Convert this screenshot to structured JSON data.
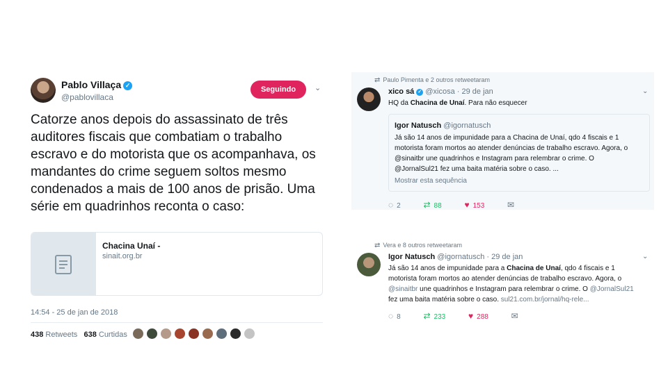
{
  "left_tweet": {
    "name": "Pablo Villaça",
    "handle": "@pablovillaca",
    "follow_button": "Seguindo",
    "text": "Catorze anos depois do assassinato de três auditores fiscais que combatiam o trabalho escravo e do motorista que os acompanhava, os mandantes do crime seguem soltos mesmo condenados a mais de 100 anos de prisão. Uma série em quadrinhos reconta o caso:",
    "card": {
      "title": "Chacina Unaí -",
      "domain": "sinait.org.br"
    },
    "timestamp": "14:54 - 25 de jan de 2018",
    "retweets_count": "438",
    "retweets_label": "Retweets",
    "likes_count": "638",
    "likes_label": "Curtidas"
  },
  "right_tweet_1": {
    "retweeted_by": "Paulo Pimenta e 2 outros retweetaram",
    "name": "xico sá",
    "handle": "@xicosa",
    "date": "· 29 de jan",
    "text_before": "HQ da ",
    "text_bold": "Chacina de Unaí",
    "text_after": ". Para não esquecer",
    "quote": {
      "name": "Igor Natusch",
      "handle": "@igornatusch",
      "line1": "Já são 14 anos de impunidade para a Chacina de Unaí, qdo 4 fiscais e 1",
      "line2": "motorista foram mortos ao atender denúncias de trabalho escravo. Agora, o",
      "line3": "@sinaitbr une quadrinhos e Instagram para relembrar o crime. O",
      "line4": "@JornalSul21 fez uma baita matéria sobre o caso. ...",
      "show_thread": "Mostrar esta sequência"
    },
    "replies": "2",
    "retweets": "88",
    "likes": "153"
  },
  "right_tweet_2": {
    "retweeted_by": "Vera e 8 outros retweetaram",
    "name": "Igor Natusch",
    "handle": "@igornatusch",
    "date": "· 29 de jan",
    "l1a": "Já são 14 anos de impunidade para a ",
    "l1b": "Chacina de Unaí",
    "l1c": ", qdo 4 fiscais e 1",
    "l2": "motorista foram mortos ao atender denúncias de trabalho escravo. Agora, o",
    "l3a": "@sinaitbr",
    "l3b": " une quadrinhos e Instagram para relembrar o crime. O ",
    "l3c": "@JornalSul21",
    "l4a": "fez uma baita matéria sobre o caso. ",
    "l4b": "sul21.com.br/jornal/hq-rele...",
    "replies": "8",
    "retweets": "233",
    "likes": "288"
  },
  "colors": {
    "accent": "#1da1f2",
    "like": "#e0245e",
    "retweet": "#17bf63",
    "muted": "#657786"
  },
  "icons": [
    "verified-icon",
    "chevron-down-icon",
    "document-icon",
    "retweet-icon",
    "reply-icon",
    "heart-icon",
    "mail-icon"
  ]
}
